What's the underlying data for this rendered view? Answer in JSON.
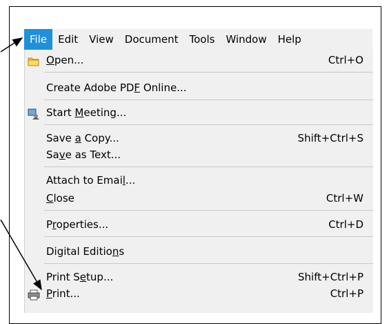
{
  "menubar": {
    "items": [
      {
        "label": "File",
        "active": true
      },
      {
        "label": "Edit"
      },
      {
        "label": "View"
      },
      {
        "label": "Document"
      },
      {
        "label": "Tools"
      },
      {
        "label": "Window"
      },
      {
        "label": "Help"
      }
    ],
    "active_color": "#1e90dc"
  },
  "file_menu": {
    "items": [
      {
        "pre": "",
        "key": "O",
        "post": "pen...",
        "shortcut": "Ctrl+O",
        "icon": "folder-icon"
      },
      {
        "pre": "Create Adobe PD",
        "key": "F",
        "post": " Online...",
        "shortcut": ""
      },
      {
        "pre": "Start ",
        "key": "M",
        "post": "eeting...",
        "shortcut": "",
        "icon": "meeting-icon"
      },
      {
        "pre": "Save ",
        "key": "a",
        "post": " Copy...",
        "shortcut": "Shift+Ctrl+S"
      },
      {
        "pre": "Sa",
        "key": "v",
        "post": "e as Text...",
        "shortcut": ""
      },
      {
        "pre": "Attach to Emai",
        "key": "l",
        "post": "...",
        "shortcut": ""
      },
      {
        "pre": "",
        "key": "C",
        "post": "lose",
        "shortcut": "Ctrl+W"
      },
      {
        "pre": "P",
        "key": "r",
        "post": "operties...",
        "shortcut": "Ctrl+D"
      },
      {
        "pre": "Digital Editio",
        "key": "n",
        "post": "s",
        "shortcut": ""
      },
      {
        "pre": "Print S",
        "key": "e",
        "post": "tup...",
        "shortcut": "Shift+Ctrl+P"
      },
      {
        "pre": "",
        "key": "P",
        "post": "rint...",
        "shortcut": "Ctrl+P",
        "icon": "printer-icon"
      }
    ]
  }
}
